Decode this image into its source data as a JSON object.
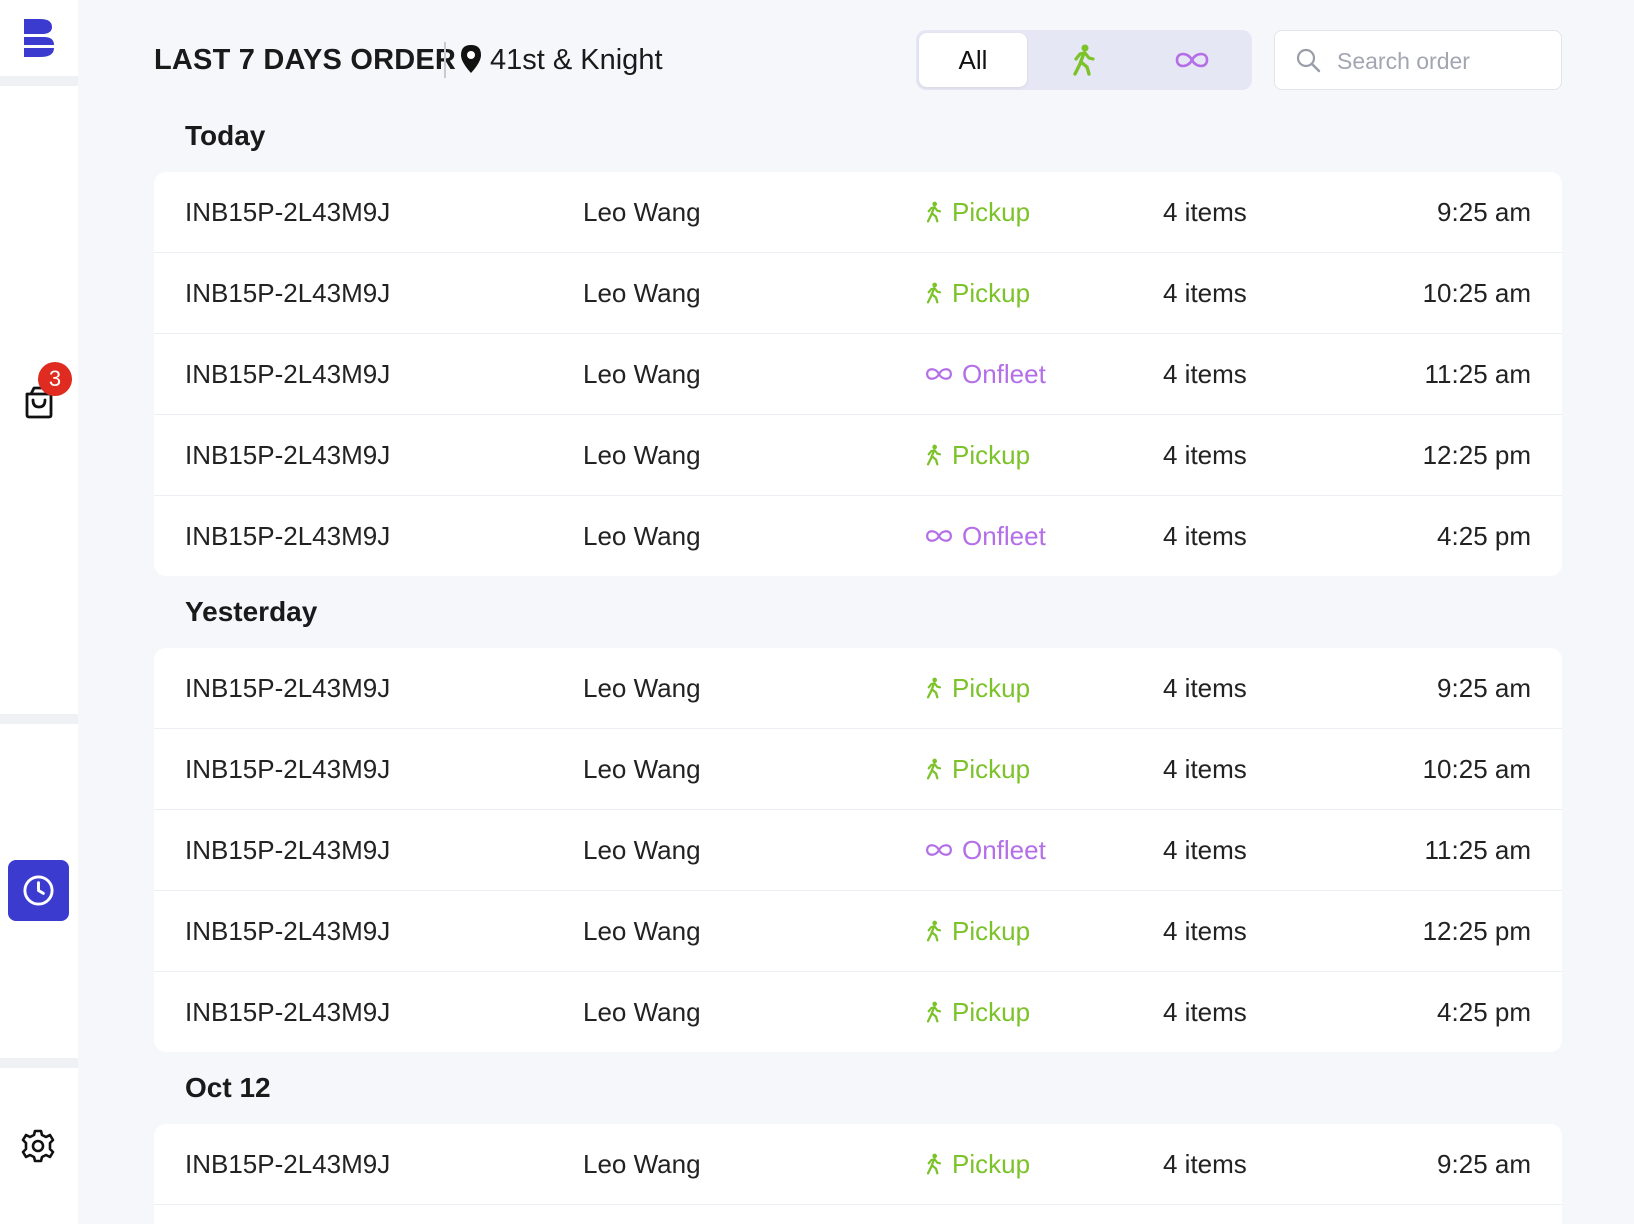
{
  "sidebar": {
    "logo": "brand-logo",
    "orders_badge": "3",
    "icons": [
      "shopping-bag-icon",
      "clock-icon",
      "gear-icon"
    ]
  },
  "header": {
    "title": "LAST 7 DAYS ORDER",
    "location": "41st & Knight",
    "filter": {
      "all_label": "All",
      "pickup_icon": "walking-person-icon",
      "onfleet_icon": "infinity-icon"
    },
    "search": {
      "placeholder": "Search order"
    }
  },
  "colors": {
    "accent": "#3b3bd0",
    "pickup": "#7cc229",
    "onfleet": "#b36ee8",
    "badge": "#e02b20"
  },
  "groups": [
    {
      "title": "Today",
      "orders": [
        {
          "id": "INB15P-2L43M9J",
          "name": "Leo Wang",
          "type": "Pickup",
          "kind": "pickup",
          "items": "4 items",
          "time": "9:25 am"
        },
        {
          "id": "INB15P-2L43M9J",
          "name": "Leo Wang",
          "type": "Pickup",
          "kind": "pickup",
          "items": "4 items",
          "time": "10:25 am"
        },
        {
          "id": "INB15P-2L43M9J",
          "name": "Leo Wang",
          "type": "Onfleet",
          "kind": "onfleet",
          "items": "4 items",
          "time": "11:25 am"
        },
        {
          "id": "INB15P-2L43M9J",
          "name": "Leo Wang",
          "type": "Pickup",
          "kind": "pickup",
          "items": "4 items",
          "time": "12:25 pm"
        },
        {
          "id": "INB15P-2L43M9J",
          "name": "Leo Wang",
          "type": "Onfleet",
          "kind": "onfleet",
          "items": "4 items",
          "time": "4:25 pm"
        }
      ]
    },
    {
      "title": "Yesterday",
      "orders": [
        {
          "id": "INB15P-2L43M9J",
          "name": "Leo Wang",
          "type": "Pickup",
          "kind": "pickup",
          "items": "4 items",
          "time": "9:25 am"
        },
        {
          "id": "INB15P-2L43M9J",
          "name": "Leo Wang",
          "type": "Pickup",
          "kind": "pickup",
          "items": "4 items",
          "time": "10:25 am"
        },
        {
          "id": "INB15P-2L43M9J",
          "name": "Leo Wang",
          "type": "Onfleet",
          "kind": "onfleet",
          "items": "4 items",
          "time": "11:25 am"
        },
        {
          "id": "INB15P-2L43M9J",
          "name": "Leo Wang",
          "type": "Pickup",
          "kind": "pickup",
          "items": "4 items",
          "time": "12:25 pm"
        },
        {
          "id": "INB15P-2L43M9J",
          "name": "Leo Wang",
          "type": "Pickup",
          "kind": "pickup",
          "items": "4 items",
          "time": "4:25 pm"
        }
      ]
    },
    {
      "title": "Oct 12",
      "orders": [
        {
          "id": "INB15P-2L43M9J",
          "name": "Leo Wang",
          "type": "Pickup",
          "kind": "pickup",
          "items": "4 items",
          "time": "9:25 am"
        }
      ]
    }
  ]
}
